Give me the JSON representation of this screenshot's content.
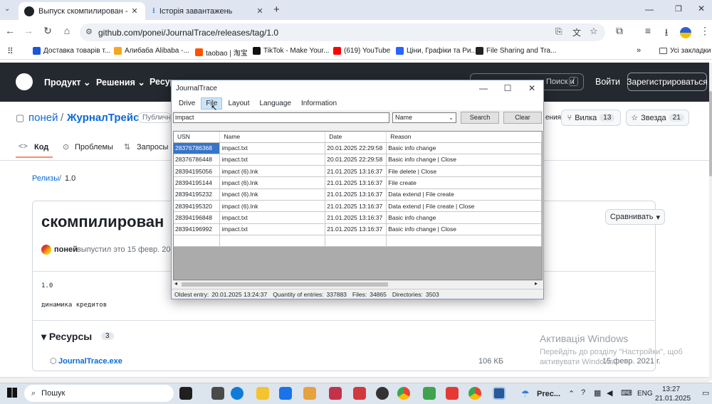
{
  "browser": {
    "tabs": [
      {
        "label": "Выпуск скомпилирован - pone",
        "active": true
      },
      {
        "label": "Історія завантажень",
        "active": false
      }
    ],
    "url": "github.com/ponei/JournalTrace/releases/tag/1.0",
    "bookmarks": [
      {
        "label": "Доставка товарів т...",
        "color": "#1a56db"
      },
      {
        "label": "Алибаба Alibaba -...",
        "color": "#f5a623"
      },
      {
        "label": "taobao | 淘宝",
        "color": "#ff5000"
      },
      {
        "label": "TikTok - Make Your...",
        "color": "#111111"
      },
      {
        "label": "(619) YouTube",
        "color": "#ff0000"
      },
      {
        "label": "Ціни, Графіки та Ри...",
        "color": "#2962ff"
      },
      {
        "label": "File Sharing and Tra...",
        "color": "#222222"
      }
    ],
    "bookmarks_folder": "Усі закладки"
  },
  "github": {
    "nav": [
      "Продукт",
      "Решения",
      "Ресур"
    ],
    "search_placeholder": "Поиск или переход к...",
    "search_key": "/",
    "login": "Войти",
    "signup": "Зарегистрироваться",
    "owner": "поней",
    "repo": "ЖурналТрейс",
    "visibility": "Публичн",
    "notif_fragment": "ения",
    "fork_label": "Вилка",
    "fork_count": "13",
    "star_label": "Звезда",
    "star_count": "21",
    "tabs": [
      "Код",
      "Проблемы",
      "Запросы к"
    ],
    "breadcrumb_releases": "Релизы",
    "breadcrumb_sep": "/",
    "breadcrumb_version": "1.0",
    "release_title": "скомпилирован",
    "compare": "Сравнивать",
    "author": "поней",
    "published": "выпустил это 15 февр. 2021",
    "body_line1": "1.0",
    "body_line2": "динамика кредитов",
    "assets_title": "Ресурсы",
    "assets_count": "3",
    "asset_name": "JournalTrace.exe",
    "asset_size": "106 КБ",
    "asset_date": "15 февр. 2021 г."
  },
  "app": {
    "title": "JournalTrace",
    "menu": [
      "Drive",
      "File",
      "Layout",
      "Language",
      "Information"
    ],
    "search_value": "impact",
    "select_value": "Name",
    "search_btn": "Search",
    "clear_btn": "Clear",
    "columns": [
      "USN",
      "Name",
      "Date",
      "Reason"
    ],
    "rows": [
      {
        "usn": "28376786368",
        "name": "impact.txt",
        "date": "20.01.2025 22:29:58",
        "reason": "Basic info change"
      },
      {
        "usn": "28376786448",
        "name": "impact.txt",
        "date": "20.01.2025 22:29:58",
        "reason": "Basic info change | Close"
      },
      {
        "usn": "28394195056",
        "name": "impact (6).lnk",
        "date": "21.01.2025 13:16:37",
        "reason": "File delete | Close"
      },
      {
        "usn": "28394195144",
        "name": "impact (6).lnk",
        "date": "21.01.2025 13:16:37",
        "reason": "File create"
      },
      {
        "usn": "28394195232",
        "name": "impact (6).lnk",
        "date": "21.01.2025 13:16:37",
        "reason": "Data extend | File create"
      },
      {
        "usn": "28394195320",
        "name": "impact (6).lnk",
        "date": "21.01.2025 13:16:37",
        "reason": "Data extend | File create | Close"
      },
      {
        "usn": "28394196848",
        "name": "impact.txt",
        "date": "21.01.2025 13:16:37",
        "reason": "Basic info change"
      },
      {
        "usn": "28394196992",
        "name": "impact.txt",
        "date": "21.01.2025 13:16:37",
        "reason": "Basic info change | Close"
      }
    ],
    "status": {
      "oldest_label": "Oldest entry:",
      "oldest_value": "20.01.2025 13:24:37",
      "qty_label": "Quantity of entries:",
      "qty_value": "337883",
      "files_label": "Files:",
      "files_value": "34865",
      "dirs_label": "Directories:",
      "dirs_value": "3503"
    }
  },
  "watermark": {
    "title": "Активація Windows",
    "line1": "Перейдіть до розділу \"Настройки\", щоб",
    "line2": "активувати Windows."
  },
  "taskbar": {
    "search": "Пошук",
    "weather": "Prec...",
    "lang": "ENG",
    "time": "13:27",
    "date": "21.01.2025"
  }
}
